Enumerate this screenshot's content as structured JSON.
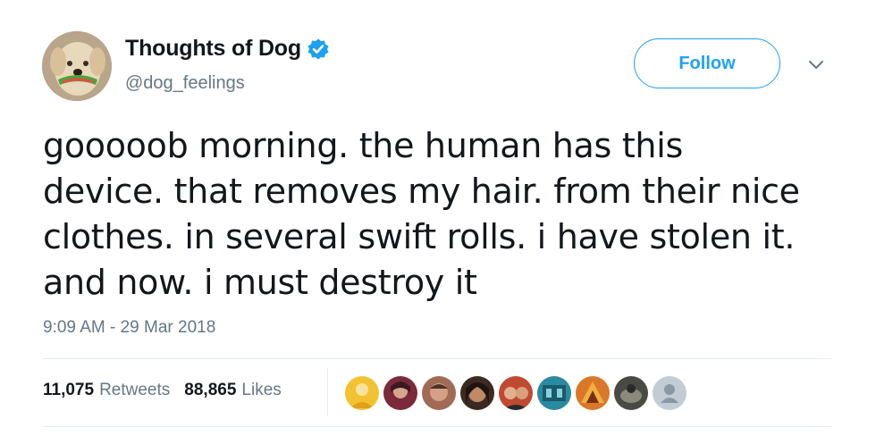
{
  "tweet": {
    "display_name": "Thoughts of Dog",
    "handle": "@dog_feelings",
    "verified": true,
    "follow_label": "Follow",
    "text_lines": [
      "gooooob morning. the human has this",
      "device. that removes my hair. from their nice",
      "clothes. in several swift rolls. i have stolen it.",
      "and now. i must destroy it"
    ],
    "timestamp": "9:09 AM - 29 Mar 2018",
    "retweets": {
      "count": "11,075",
      "label": "Retweets"
    },
    "likes": {
      "count": "88,865",
      "label": "Likes"
    }
  },
  "icons": {
    "verified": "verified-badge-icon",
    "caret": "chevron-down-icon",
    "default_avatar": "default-user-icon"
  },
  "colors": {
    "brand_blue": "#1da1f2",
    "secondary_text": "#657786",
    "divider": "#e6ecf0"
  },
  "liker_avatar_colors": [
    "#f2c230",
    "#7a2a3a",
    "#a06a55",
    "#3b2a22",
    "#c04a30",
    "#2a8aa0",
    "#d9782a",
    "#4a4a44",
    "#c3ccd4"
  ]
}
